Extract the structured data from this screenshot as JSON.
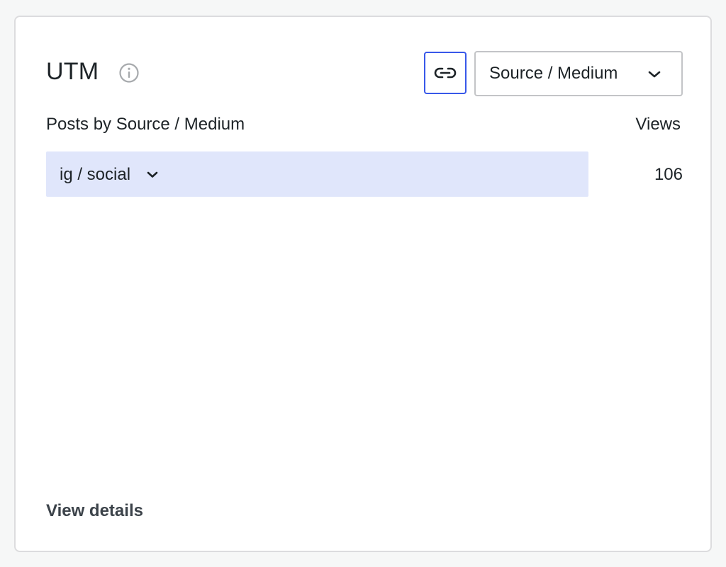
{
  "module": {
    "title": "UTM",
    "info_icon": "info-icon",
    "link_icon": "link-icon",
    "selector": {
      "selected": "Source / Medium",
      "icon": "chevron-down-icon"
    }
  },
  "table": {
    "heading": "Posts by Source / Medium",
    "views_heading": "Views",
    "rows": [
      {
        "label": "ig / social",
        "views": "106",
        "icon": "chevron-down-icon"
      }
    ]
  },
  "footer": {
    "view_details": "View details"
  },
  "colors": {
    "accent": "#3858e9",
    "row_bar": "#e0e6fb",
    "text": "#1d2327",
    "border": "#dcdcde"
  }
}
